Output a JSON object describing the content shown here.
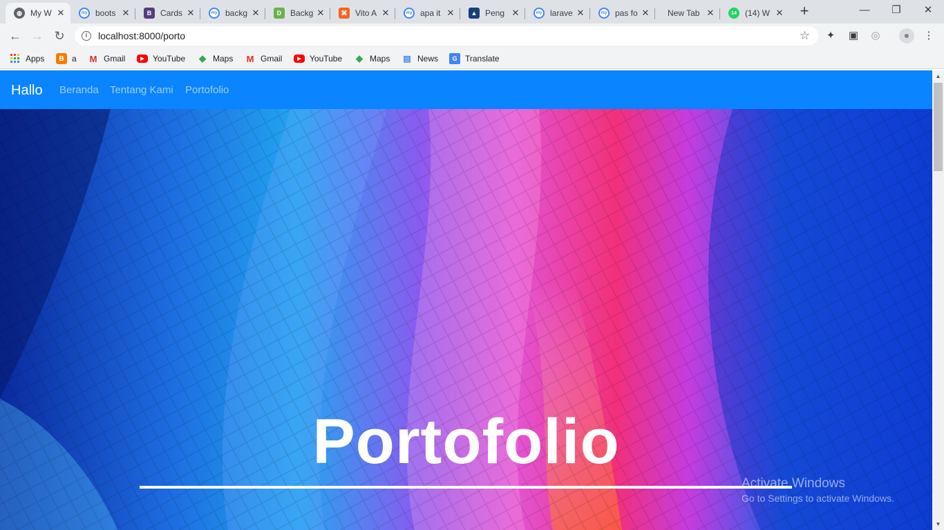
{
  "browser": {
    "tabs": [
      {
        "title": "My W",
        "favicon": "globe-icon",
        "color": "#5f6368",
        "active": true
      },
      {
        "title": "boots",
        "favicon": "my-icon",
        "color": "#4285f4"
      },
      {
        "title": "Cards",
        "favicon": "bootstrap-icon",
        "color": "#563d7c"
      },
      {
        "title": "backg",
        "favicon": "my-icon",
        "color": "#4285f4"
      },
      {
        "title": "Backg",
        "favicon": "greenbox-icon",
        "color": "#6ab04c"
      },
      {
        "title": "Vito A",
        "favicon": "orange-icon",
        "color": "#f26522"
      },
      {
        "title": "apa it",
        "favicon": "my-icon",
        "color": "#4285f4"
      },
      {
        "title": "Peng",
        "favicon": "navy-icon",
        "color": "#1a3d7c"
      },
      {
        "title": "larave",
        "favicon": "my-icon",
        "color": "#4285f4"
      },
      {
        "title": "pas fo",
        "favicon": "my-icon",
        "color": "#4285f4"
      },
      {
        "title": "New Tab",
        "favicon": "none",
        "color": "#dee1e6"
      },
      {
        "title": "(14) W",
        "favicon": "whatsapp-icon",
        "color": "#25d366",
        "badge": "14"
      }
    ],
    "close_glyph": "✕",
    "url": "localhost:8000/porto",
    "bookmarks": [
      {
        "label": "Apps",
        "icon": "apps-grid-icon",
        "color": "#4285f4"
      },
      {
        "label": "a",
        "icon": "blogger-icon",
        "color": "#f57d00"
      },
      {
        "label": "Gmail",
        "icon": "gmail-icon",
        "color": "#d93025"
      },
      {
        "label": "YouTube",
        "icon": "youtube-icon",
        "color": "#ff0000"
      },
      {
        "label": "Maps",
        "icon": "maps-icon",
        "color": "#34a853"
      },
      {
        "label": "Gmail",
        "icon": "gmail-icon",
        "color": "#d93025"
      },
      {
        "label": "YouTube",
        "icon": "youtube-icon",
        "color": "#ff0000"
      },
      {
        "label": "Maps",
        "icon": "maps-icon",
        "color": "#34a853"
      },
      {
        "label": "News",
        "icon": "news-icon",
        "color": "#4285f4"
      },
      {
        "label": "Translate",
        "icon": "translate-icon",
        "color": "#4285f4"
      }
    ]
  },
  "navbar": {
    "brand": "Hallo",
    "links": [
      "Beranda",
      "Tentang Kami",
      "Portofolio"
    ],
    "color": "#0a84ff"
  },
  "hero": {
    "title": "Portofolio"
  },
  "watermark": {
    "line1": "Activate Windows",
    "line2": "Go to Settings to activate Windows."
  }
}
